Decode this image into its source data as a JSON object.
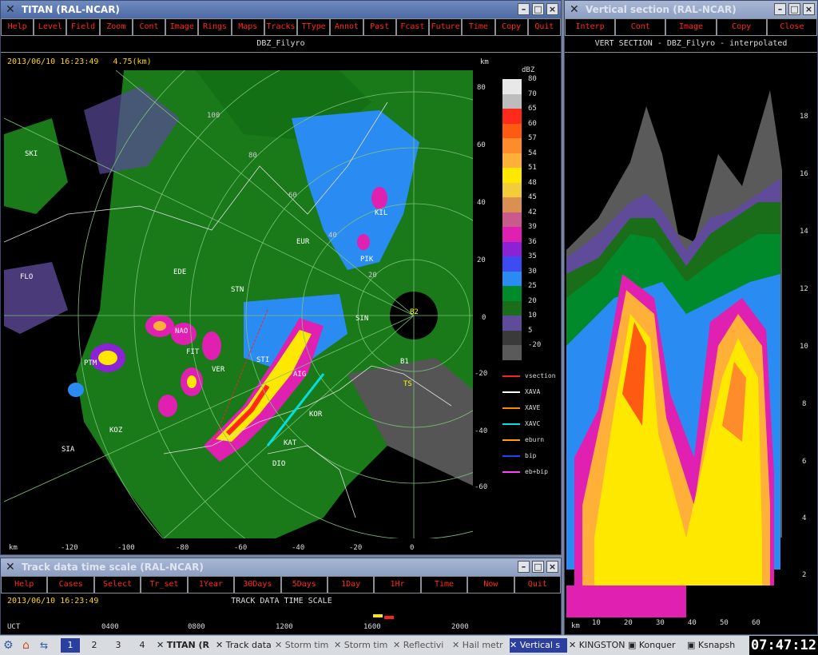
{
  "titan": {
    "title": "TITAN (RAL-NCAR)",
    "menu": [
      "Help",
      "Level",
      "Field",
      "Zoom",
      "Cont",
      "Image",
      "Rings",
      "Maps",
      "Tracks",
      "TType",
      "Annot",
      "Past",
      "Fcast",
      "Future",
      "Time",
      "Copy",
      "Quit"
    ],
    "field_label": "DBZ_Filyro",
    "datetime": "2013/06/10 16:23:49   4.75(km)",
    "km_unit": "km",
    "y_ticks": [
      "80",
      "60",
      "40",
      "20",
      "0",
      "-20",
      "-40",
      "-60"
    ],
    "x_ticks": [
      "-120",
      "-100",
      "-80",
      "-60",
      "-40",
      "-20",
      "0"
    ],
    "colorbar": {
      "unit": "dBZ",
      "levels": [
        {
          "label": "80",
          "color": "#e8e8e8"
        },
        {
          "label": "70",
          "color": "#bdbdbd"
        },
        {
          "label": "65",
          "color": "#ff2a1a"
        },
        {
          "label": "60",
          "color": "#ff5a12"
        },
        {
          "label": "57",
          "color": "#ff8c2a"
        },
        {
          "label": "54",
          "color": "#ffb038"
        },
        {
          "label": "51",
          "color": "#ffe800"
        },
        {
          "label": "48",
          "color": "#f2cc3a"
        },
        {
          "label": "45",
          "color": "#d99050"
        },
        {
          "label": "42",
          "color": "#c85a8c"
        },
        {
          "label": "39",
          "color": "#e020b0"
        },
        {
          "label": "36",
          "color": "#8c22d6"
        },
        {
          "label": "35",
          "color": "#3c4cf2"
        },
        {
          "label": "30",
          "color": "#2a8cf2"
        },
        {
          "label": "25",
          "color": "#008a2c"
        },
        {
          "label": "20",
          "color": "#1a6e1a"
        },
        {
          "label": "10",
          "color": "#604a9a"
        },
        {
          "label": "5",
          "color": "#3a3a3a"
        },
        {
          "label": "-20",
          "color": "#5a5a5a"
        }
      ]
    },
    "legend": [
      {
        "label": "vsection",
        "color": "#ff2020"
      },
      {
        "label": "XAVA",
        "color": "#ffffff"
      },
      {
        "label": "XAVE",
        "color": "#ff8c00"
      },
      {
        "label": "XAVC",
        "color": "#00e0e0"
      },
      {
        "label": "eburn",
        "color": "#ffa000"
      },
      {
        "label": "bip",
        "color": "#2040ff"
      },
      {
        "label": "eb+bip",
        "color": "#ff40ff"
      }
    ],
    "place_labels": [
      "SKI",
      "FLO",
      "EDE",
      "STN",
      "EUR",
      "KIL",
      "PIK",
      "SIN",
      "B2",
      "NAO",
      "FIT",
      "VER",
      "PTM",
      "STI",
      "AIG",
      "KOR",
      "KAT",
      "KOZ",
      "SIA",
      "DIO",
      "B1",
      "TS"
    ],
    "ring_labels": [
      "100",
      "80",
      "60",
      "40",
      "20"
    ]
  },
  "vsec": {
    "title": "Vertical section (RAL-NCAR)",
    "menu": [
      "Interp",
      "Cont",
      "Image",
      "Copy",
      "Close"
    ],
    "header": "VERT SECTION - DBZ_Filyro - interpolated",
    "y_ticks": [
      "18",
      "16",
      "14",
      "12",
      "10",
      "8",
      "6",
      "4",
      "2"
    ],
    "x_ticks": [
      "10",
      "20",
      "30",
      "40",
      "50",
      "60"
    ],
    "km_unit": "km"
  },
  "track": {
    "title": "Track data time scale (RAL-NCAR)",
    "menu": [
      "Help",
      "Cases",
      "Select",
      "Tr_set",
      "1Year",
      "30Days",
      "5Days",
      "1Day",
      "1Hr",
      "Time",
      "Now",
      "Quit"
    ],
    "datetime": "2013/06/10 16:23:49",
    "heading": "TRACK DATA TIME SCALE",
    "axis_unit": "UCT",
    "axis_ticks": [
      "0400",
      "0800",
      "1200",
      "1600",
      "2000"
    ]
  },
  "taskbar": {
    "desktops": [
      "1",
      "2",
      "3",
      "4"
    ],
    "tasks": [
      "TITAN (R",
      "Track data",
      "Storm tim",
      "Storm tim",
      "Reflectivi",
      "Hail metr",
      "Vertical s",
      "KINGSTON",
      "Konquer",
      "Ksnapsh"
    ],
    "clock": "07:47:12"
  }
}
